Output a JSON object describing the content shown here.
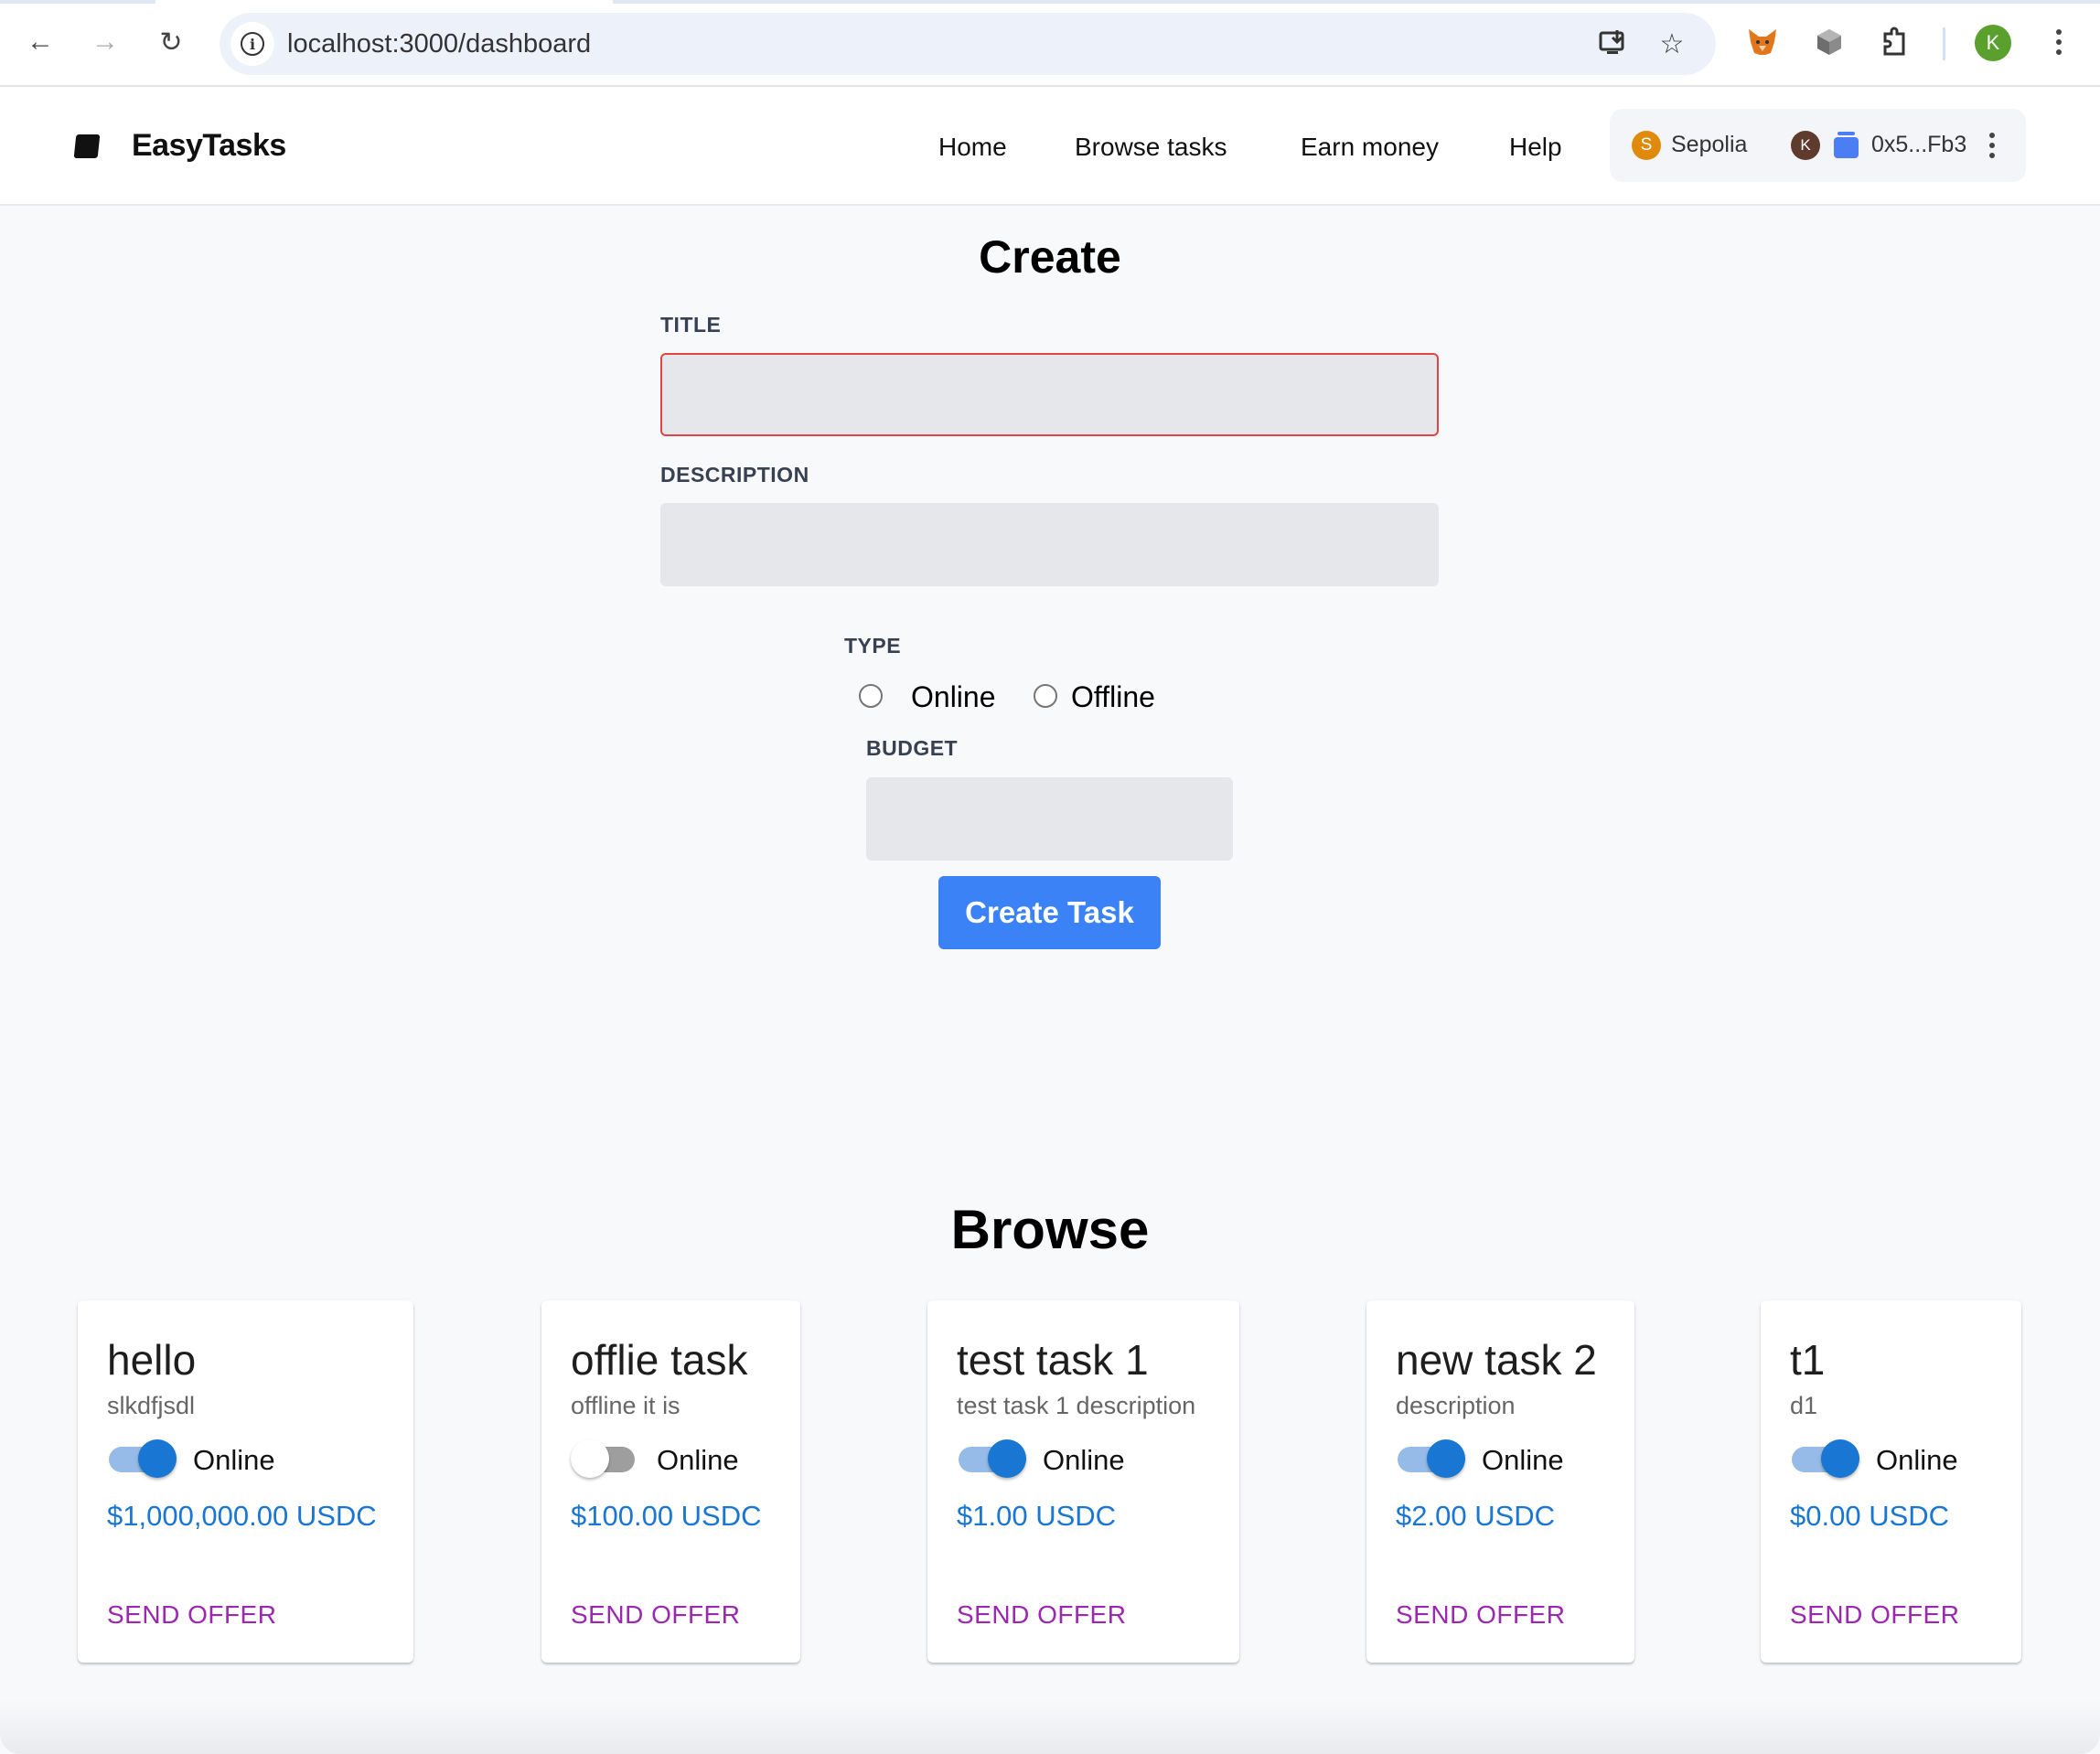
{
  "browser": {
    "url": "localhost:3000/dashboard",
    "back_icon": "arrow-left-icon",
    "forward_icon": "arrow-right-icon",
    "reload_icon": "reload-icon",
    "site_info_icon": "info-icon",
    "install_icon": "install-app-icon",
    "bookmark_icon": "star-icon",
    "extensions": [
      "metamask-fox-icon",
      "cube-extension-icon",
      "puzzle-extensions-icon"
    ],
    "profile_initial": "K"
  },
  "header": {
    "brand": "EasyTasks",
    "nav": [
      "Home",
      "Browse tasks",
      "Earn money",
      "Help"
    ],
    "wallet": {
      "chain_initial": "S",
      "chain_name": "Sepolia",
      "account_initial": "K",
      "address": "0x5...Fb3"
    }
  },
  "create": {
    "heading": "Create",
    "title_label": "TITLE",
    "title_value": "",
    "description_label": "DESCRIPTION",
    "description_value": "",
    "type_label": "TYPE",
    "type_options": [
      "Online",
      "Offline"
    ],
    "type_selected": null,
    "budget_label": "BUDGET",
    "budget_value": "",
    "submit_label": "Create Task",
    "title_error_color": "#e04444",
    "accent_color": "#3b82f6"
  },
  "browse": {
    "heading": "Browse",
    "toggle_label": "Online",
    "offer_label": "SEND OFFER",
    "tasks": [
      {
        "title": "hello",
        "description": "slkdfjsdl",
        "online": true,
        "price": "$1,000,000.00 USDC"
      },
      {
        "title": "offlie task",
        "description": "offline it is",
        "online": false,
        "price": "$100.00 USDC"
      },
      {
        "title": "test task 1",
        "description": "test task 1 description",
        "online": true,
        "price": "$1.00 USDC"
      },
      {
        "title": "new task 2",
        "description": "description",
        "online": true,
        "price": "$2.00 USDC"
      },
      {
        "title": "t1",
        "description": "d1",
        "online": true,
        "price": "$0.00 USDC"
      }
    ]
  }
}
